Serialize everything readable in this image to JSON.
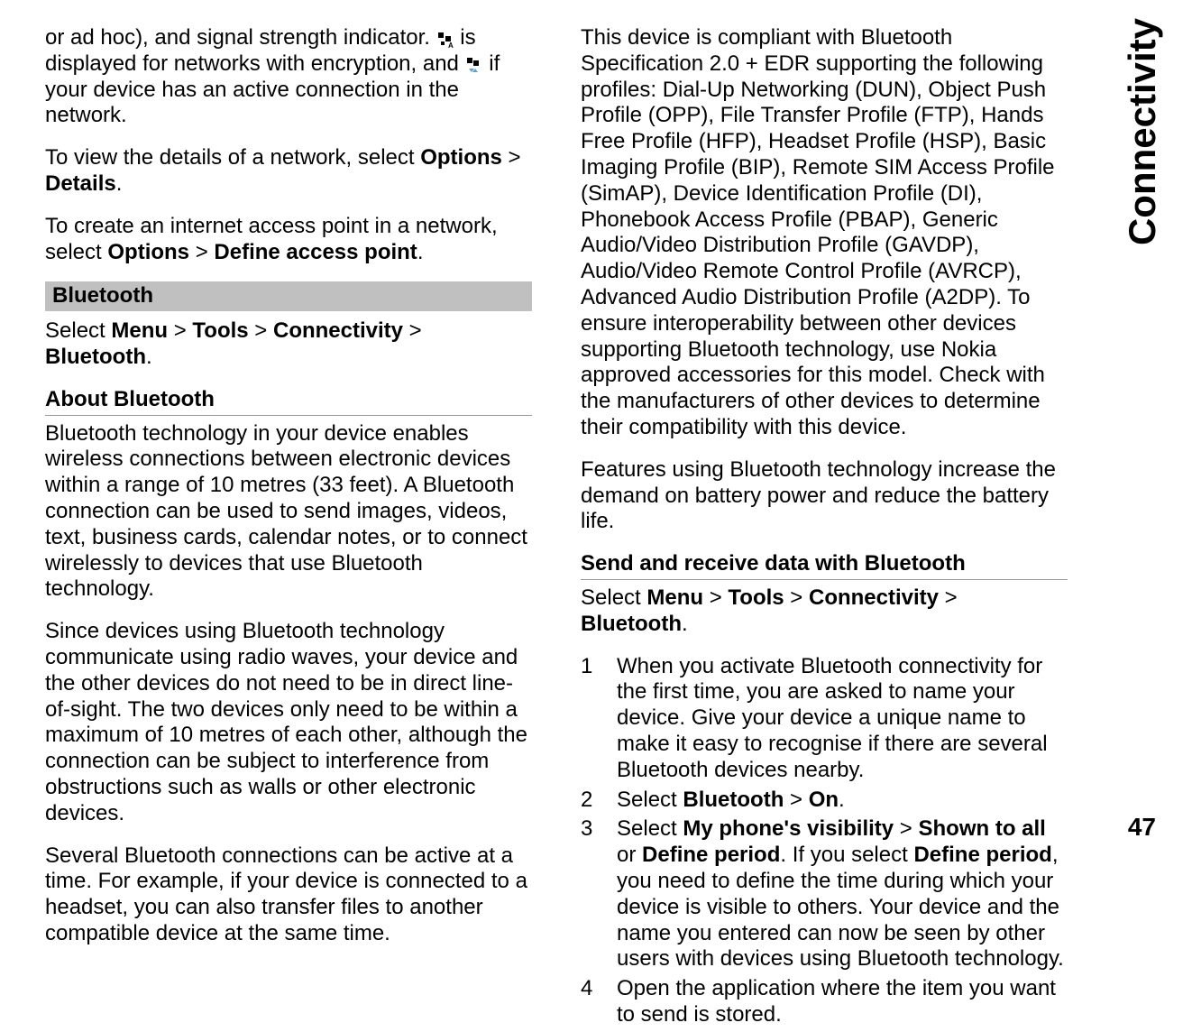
{
  "sideLabel": "Connectivity",
  "pageNumber": "47",
  "left": {
    "p1_a": "or ad hoc), and signal strength indicator. ",
    "p1_b": " is displayed for networks with encryption, and ",
    "p1_c": " if your device has an active connection in the network.",
    "p2_a": "To view the details of a network, select ",
    "p2_opt": "Options",
    "p2_gt": " > ",
    "p2_det": "Details",
    "p2_dot": ".",
    "p3_a": "To create an internet access point in a network, select ",
    "p3_opt": "Options",
    "p3_gt": " > ",
    "p3_def": "Define access point",
    "p3_dot": ".",
    "bar_bt": "Bluetooth",
    "p4_a": "Select ",
    "p4_m": "Menu",
    "p4_t": "Tools",
    "p4_c": "Connectivity",
    "p4_b": "Bluetooth",
    "p4_dot": ".",
    "gt": " > ",
    "sub_about": "About Bluetooth",
    "p5": "Bluetooth technology in your device enables wireless connections between electronic devices within a range of 10 metres (33 feet). A Bluetooth connection can be used to send images, videos, text, business cards, calendar notes, or to connect wirelessly to devices that use Bluetooth technology.",
    "p6": "Since devices using Bluetooth technology communicate using radio waves, your device and the other devices do not need to be in direct line-of-sight. The two devices only need to be within a maximum of 10 metres of each other, although the connection can be subject to interference from obstructions such as walls or other electronic devices.",
    "p7": "Several Bluetooth connections can be active at a time. For example, if your device is connected to a headset, you can also transfer files to another compatible device at the same time."
  },
  "right": {
    "p1": "This device is compliant with Bluetooth Specification 2.0 + EDR supporting the following profiles: Dial-Up Networking (DUN), Object Push Profile (OPP), File Transfer Profile (FTP), Hands Free Profile (HFP), Headset Profile (HSP), Basic Imaging Profile (BIP), Remote SIM Access Profile (SimAP), Device Identification Profile (DI), Phonebook Access Profile (PBAP), Generic Audio/Video Distribution Profile (GAVDP), Audio/Video Remote Control Profile (AVRCP), Advanced Audio Distribution Profile (A2DP). To ensure interoperability between other devices supporting Bluetooth technology, use Nokia approved accessories for this model. Check with the manufacturers of other devices to determine their compatibility with this device.",
    "p2": "Features using Bluetooth technology increase the demand on battery power and reduce the battery life.",
    "sub_send": "Send and receive data with Bluetooth",
    "p3_a": "Select ",
    "p3_m": "Menu",
    "p3_t": "Tools",
    "p3_c": "Connectivity",
    "p3_b": "Bluetooth",
    "p3_dot": ".",
    "gt": " > ",
    "li1": "When you activate Bluetooth connectivity for the first time, you are asked to name your device. Give your device a unique name to make it easy to recognise if there are several Bluetooth devices nearby.",
    "li2_a": "Select ",
    "li2_bt": "Bluetooth",
    "li2_on": "On",
    "li2_dot": ".",
    "li3_a": "Select ",
    "li3_vis": "My phone's visibility",
    "li3_shown": "Shown to all",
    "li3_or": " or ",
    "li3_def1": "Define period",
    "li3_mid": ". If you select ",
    "li3_def2": "Define period",
    "li3_rest": ", you need to define the time during which your device is visible to others. Your device and the name you entered can now be seen by other users with devices using Bluetooth technology.",
    "li4": "Open the application where the item you want to send is stored.",
    "n1": "1",
    "n2": "2",
    "n3": "3",
    "n4": "4"
  }
}
